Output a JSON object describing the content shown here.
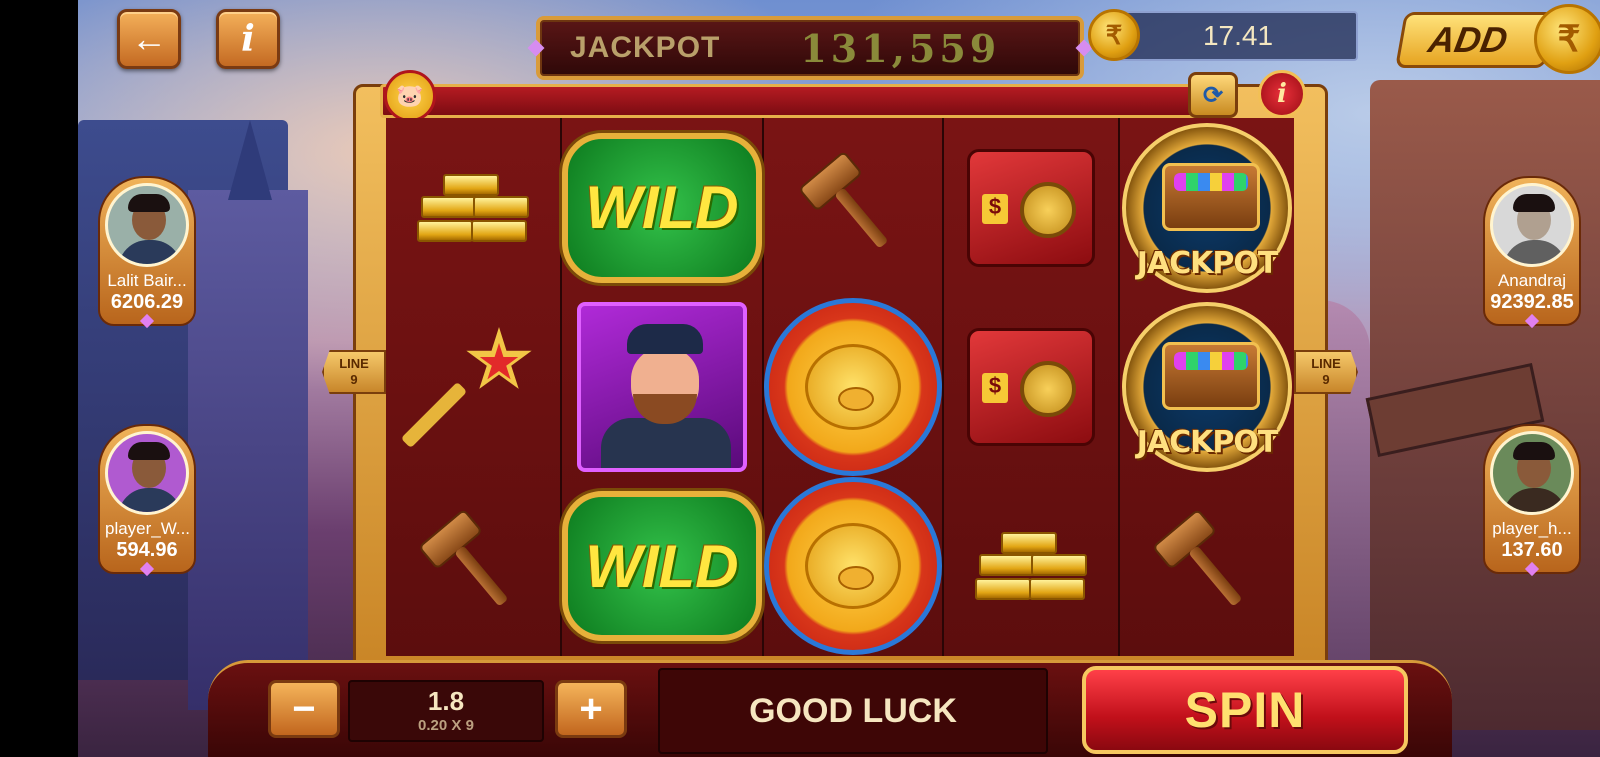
{
  "top_bar": {
    "back_icon": "arrow-left-icon",
    "info_label": "i",
    "jackpot_label": "JACKPOT",
    "jackpot_value": "131,559",
    "currency_symbol": "₹",
    "balance": "17.41",
    "add_label": "ADD"
  },
  "frame": {
    "info_label": "i",
    "line_label": "LINE",
    "line_count": "9"
  },
  "reels": [
    [
      "gold-bars",
      "key-star",
      "gavel"
    ],
    [
      "wild",
      "policeman",
      "wild"
    ],
    [
      "gavel",
      "pig-coin",
      "pig-coin"
    ],
    [
      "safe",
      "safe",
      "gold-bars"
    ],
    [
      "jackpot-chest",
      "jackpot-chest",
      "gavel"
    ]
  ],
  "symbols": {
    "wild_text": "WILD",
    "jackpot_text": "JACKPOT",
    "safe_text": "$"
  },
  "players": {
    "left": [
      {
        "name": "Lalit Bair...",
        "score": "6206.29"
      },
      {
        "name": "player_W...",
        "score": "594.96"
      }
    ],
    "right": [
      {
        "name": "Anandraj",
        "score": "92392.85"
      },
      {
        "name": "player_h...",
        "score": "137.60"
      }
    ]
  },
  "bottom": {
    "minus_label": "−",
    "plus_label": "+",
    "bet_value": "1.8",
    "bet_formula": "0.20 X 9",
    "message": "GOOD LUCK",
    "spin_label": "SPIN"
  }
}
